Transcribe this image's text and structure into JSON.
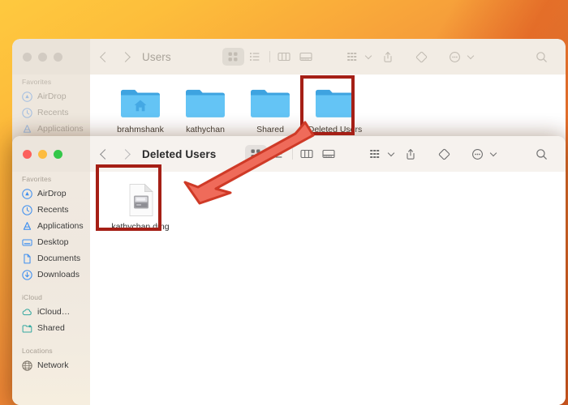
{
  "desktop": {
    "background_top": "#fec93f",
    "background_bottom": "#dc5c24"
  },
  "annotations": {
    "box_color": "#a51f16",
    "arrow_fill": "#ef6b5a",
    "arrow_stroke": "#cf3a27",
    "arrow_label": "arrow pointing from Deleted Users folder to kathychan.dmg",
    "highlighted_folder": "Deleted Users",
    "highlighted_file": "kathychan.dmg"
  },
  "window_users": {
    "title": "Users",
    "active": false,
    "traffic_lights": [
      "close",
      "minimize",
      "zoom"
    ],
    "nav": {
      "back": "back-chevron",
      "forward": "forward-chevron"
    },
    "toolbar": {
      "view_icon_grid": "icon-view",
      "view_list": "list-view",
      "view_column": "column-view",
      "view_gallery": "gallery-view",
      "group_by": "group-by",
      "share": "share",
      "tags": "tags",
      "more": "more-options",
      "search": "search"
    },
    "sidebar": {
      "sections": [
        {
          "header": "Favorites",
          "items": [
            {
              "label": "AirDrop",
              "icon": "airdrop-icon"
            },
            {
              "label": "Recents",
              "icon": "clock-icon"
            },
            {
              "label": "Applications",
              "icon": "applications-icon"
            }
          ]
        }
      ]
    },
    "files": [
      {
        "name": "brahmshank",
        "type": "folder",
        "badge": "home"
      },
      {
        "name": "kathychan",
        "type": "folder",
        "badge": ""
      },
      {
        "name": "Shared",
        "type": "folder",
        "badge": ""
      },
      {
        "name": "Deleted Users",
        "type": "folder",
        "badge": "",
        "highlighted": true
      }
    ]
  },
  "window_deleted": {
    "title": "Deleted Users",
    "active": true,
    "traffic_lights": [
      "close",
      "minimize",
      "zoom"
    ],
    "nav": {
      "back": "back-chevron",
      "forward": "forward-chevron"
    },
    "toolbar": {
      "view_icon_grid": "icon-view",
      "view_list": "list-view",
      "view_column": "column-view",
      "view_gallery": "gallery-view",
      "group_by": "group-by",
      "share": "share",
      "tags": "tags",
      "more": "more-options",
      "search": "search"
    },
    "sidebar": {
      "sections": [
        {
          "header": "Favorites",
          "items": [
            {
              "label": "AirDrop",
              "icon": "airdrop-icon"
            },
            {
              "label": "Recents",
              "icon": "clock-icon"
            },
            {
              "label": "Applications",
              "icon": "applications-icon"
            },
            {
              "label": "Desktop",
              "icon": "desktop-icon"
            },
            {
              "label": "Documents",
              "icon": "document-icon"
            },
            {
              "label": "Downloads",
              "icon": "downloads-icon"
            }
          ]
        },
        {
          "header": "iCloud",
          "items": [
            {
              "label": "iCloud…",
              "icon": "cloud-icon"
            },
            {
              "label": "Shared",
              "icon": "shared-folder-icon"
            }
          ]
        },
        {
          "header": "Locations",
          "items": [
            {
              "label": "Network",
              "icon": "globe-icon"
            }
          ]
        }
      ]
    },
    "files": [
      {
        "name": "kathychan.dmg",
        "type": "disk-image",
        "highlighted": true
      }
    ]
  }
}
